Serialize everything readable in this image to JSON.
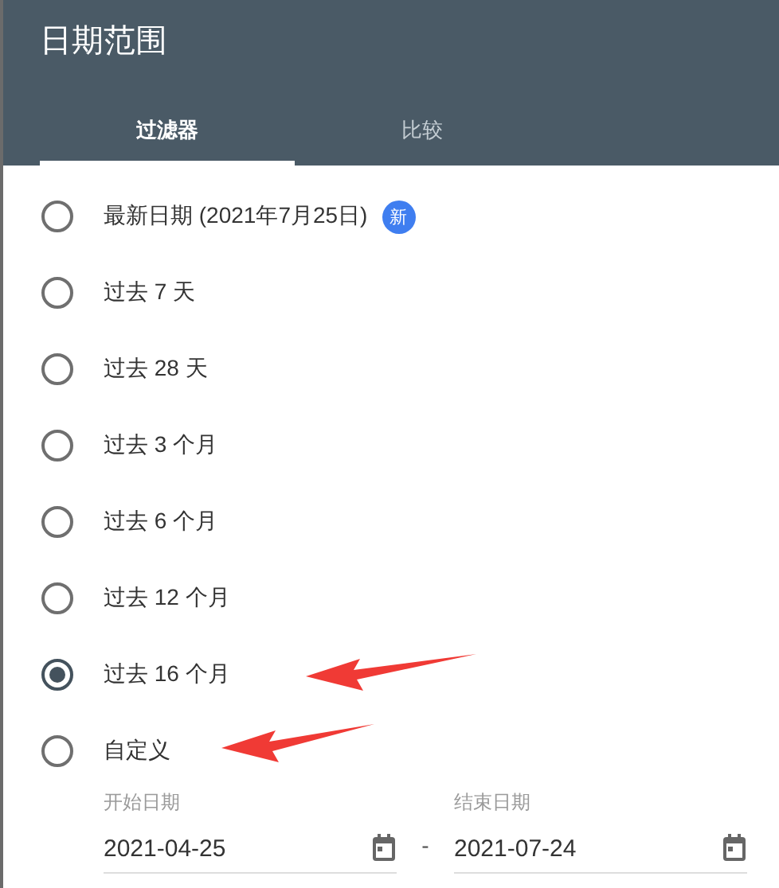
{
  "title": "日期范围",
  "tabs": [
    {
      "label": "过滤器",
      "selected": true
    },
    {
      "label": "比较",
      "selected": false
    }
  ],
  "options": [
    {
      "label": "最新日期 (2021年7月25日)",
      "selected": false,
      "badge": "新"
    },
    {
      "label": "过去 7 天",
      "selected": false
    },
    {
      "label": "过去 28 天",
      "selected": false
    },
    {
      "label": "过去 3 个月",
      "selected": false
    },
    {
      "label": "过去 6 个月",
      "selected": false
    },
    {
      "label": "过去 12 个月",
      "selected": false
    },
    {
      "label": "过去 16 个月",
      "selected": true
    },
    {
      "label": "自定义",
      "selected": false
    }
  ],
  "custom_range": {
    "start": {
      "label": "开始日期",
      "value": "2021-04-25"
    },
    "separator": "-",
    "end": {
      "label": "结束日期",
      "value": "2021-07-24"
    }
  },
  "annotations": [
    {
      "kind": "arrow"
    },
    {
      "kind": "arrow"
    }
  ]
}
